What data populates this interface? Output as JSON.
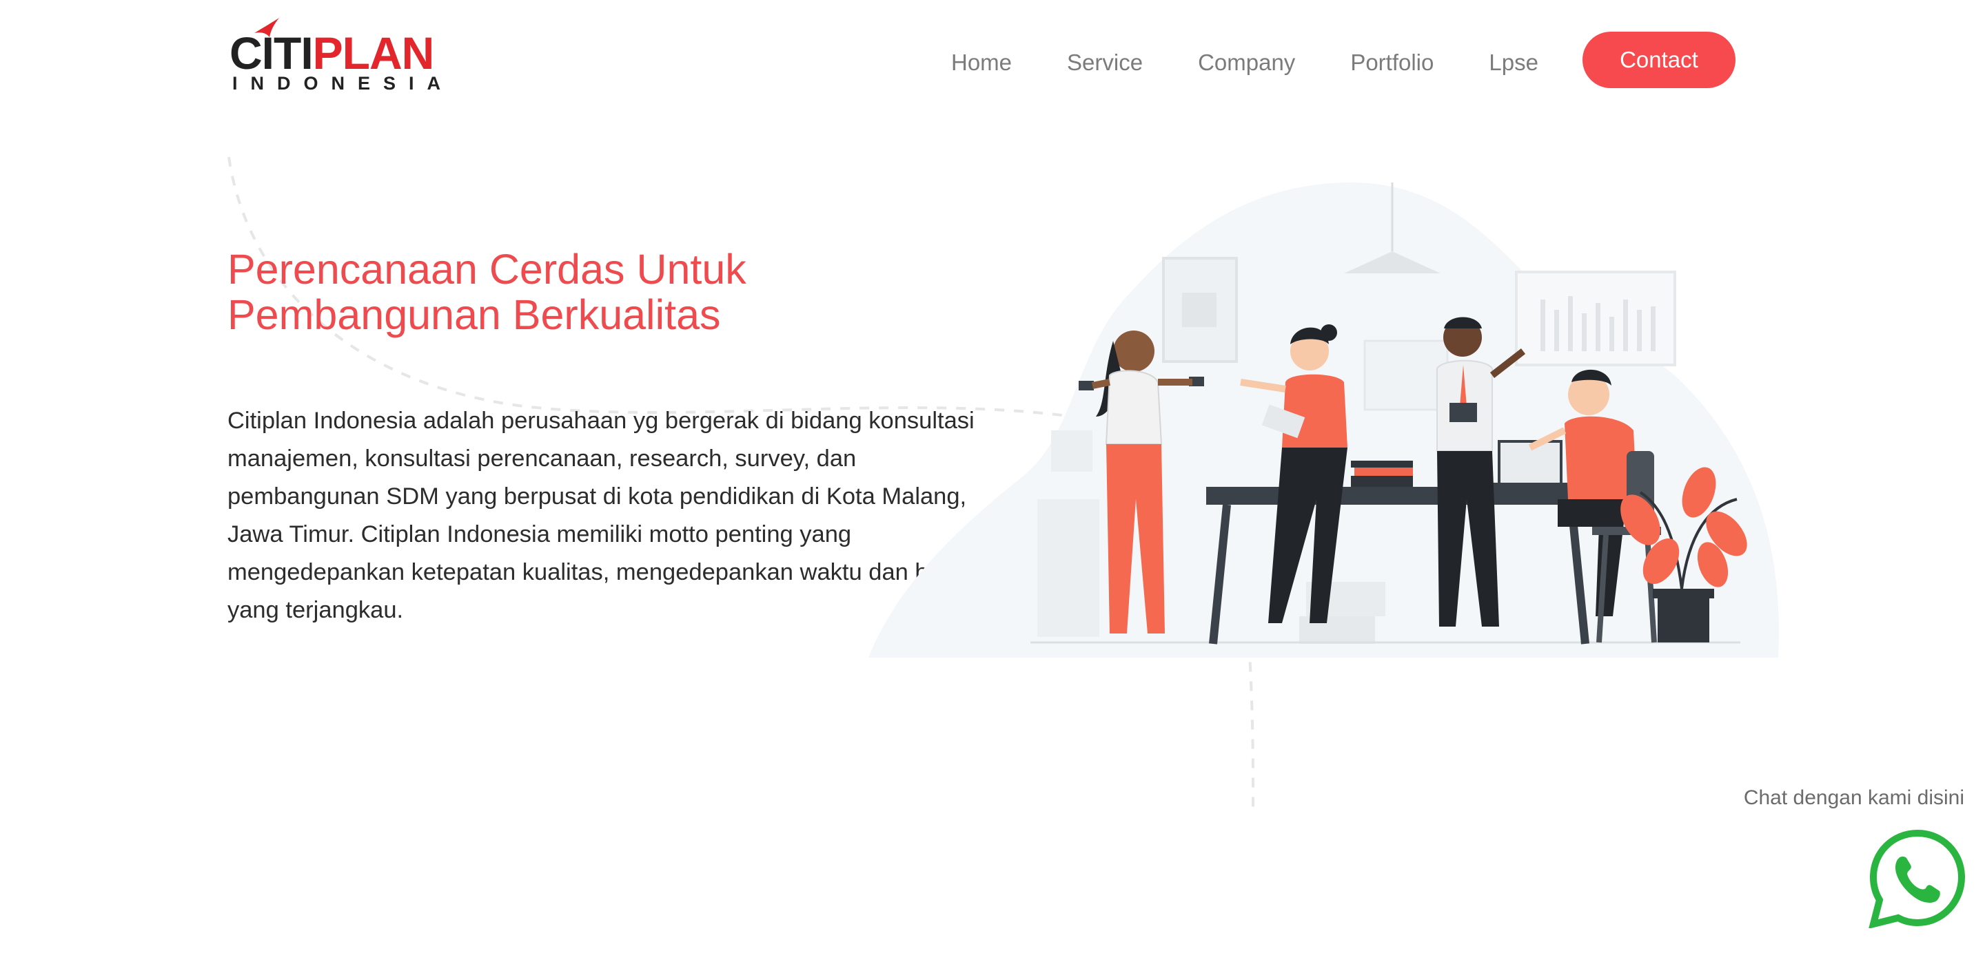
{
  "header": {
    "logo": {
      "word_part1": "CITI",
      "word_part2": "PLAN",
      "subtitle": "INDONESIA",
      "brand_red": "#e3262b",
      "brand_dark": "#222222"
    },
    "nav": {
      "items": [
        {
          "label": "Home"
        },
        {
          "label": "Service"
        },
        {
          "label": "Company"
        },
        {
          "label": "Portfolio"
        },
        {
          "label": "Lpse"
        }
      ],
      "contact_label": "Contact"
    }
  },
  "hero": {
    "title_line1": "Perencanaan Cerdas Untuk",
    "title_line2": "Pembangunan Berkualitas",
    "description": "Citiplan Indonesia adalah perusahaan yg bergerak di bidang konsultasi manajemen, konsultasi perencanaan, research, survey, dan pembangunan SDM yang berpusat di kota pendidikan di Kota Malang, Jawa Timur. Citiplan Indonesia memiliki motto penting yang mengedepankan ketepatan kualitas, mengedepankan waktu dan biaya yang terjangkau.",
    "illustration_icon": "office-team-illustration"
  },
  "chat": {
    "label": "Chat dengan kami disini",
    "icon": "whatsapp-icon",
    "color": "#2ab540"
  },
  "colors": {
    "accent": "#f74a4f",
    "title": "#ef4b4f",
    "body_text": "#2c2c2c",
    "nav_text": "#7b7b7b"
  }
}
